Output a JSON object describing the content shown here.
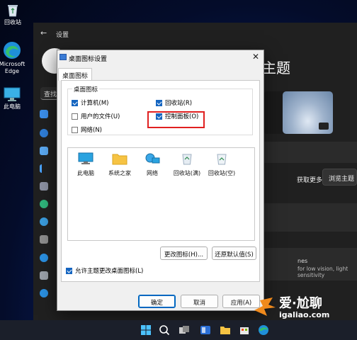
{
  "desktop": {
    "icons": [
      {
        "label": "回收站",
        "icon": "recycle-bin-icon"
      },
      {
        "label": "Microsoft Edge",
        "icon": "edge-icon"
      },
      {
        "label": "此电脑",
        "icon": "this-pc-icon"
      }
    ]
  },
  "settings": {
    "title": "设置",
    "search_placeholder": "查找",
    "heading": "主题",
    "get_more_label": "获取更多主题",
    "browse_button": "浏览主题",
    "hc_title": "nes",
    "hc_desc": "for low vision, light sensitivity"
  },
  "dialog": {
    "title": "桌面图标设置",
    "tab": "桌面图标",
    "group_label": "桌面图标",
    "checkboxes": [
      {
        "label": "计算机(M)",
        "checked": true
      },
      {
        "label": "回收站(R)",
        "checked": true
      },
      {
        "label": "用户的文件(U)",
        "checked": false
      },
      {
        "label": "控制面板(O)",
        "checked": true
      },
      {
        "label": "网络(N)",
        "checked": false
      }
    ],
    "icons": [
      {
        "label": "此电脑",
        "icon": "monitor-icon"
      },
      {
        "label": "系统之家",
        "icon": "folder-icon"
      },
      {
        "label": "网络",
        "icon": "network-icon"
      },
      {
        "label": "回收站(满)",
        "icon": "recycle-bin-full-icon"
      },
      {
        "label": "回收站(空)",
        "icon": "recycle-bin-empty-icon"
      }
    ],
    "change_icon_button": "更改图标(H)...",
    "restore_default_button": "还原默认值(S)",
    "allow_themes_label": "允许主题更改桌面图标(L)",
    "allow_themes_checked": true,
    "ok_button": "确定",
    "cancel_button": "取消",
    "apply_button": "应用(A)"
  },
  "watermark": {
    "text": "爱·尬聊",
    "url": "igaliao.com"
  },
  "colors": {
    "accent": "#1565c0",
    "highlight_box": "#e02020",
    "settings_bg": "#202020"
  }
}
